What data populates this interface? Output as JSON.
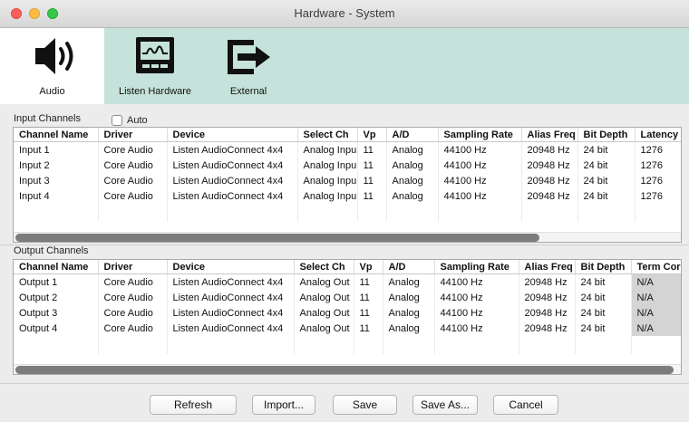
{
  "window": {
    "title": "Hardware - System"
  },
  "toolbar": {
    "items": [
      {
        "label": "Audio",
        "icon": "speaker-icon"
      },
      {
        "label": "Listen Hardware",
        "icon": "hardware-monitor-icon"
      },
      {
        "label": "External",
        "icon": "external-export-icon"
      }
    ]
  },
  "input_section": {
    "label": "Input Channels",
    "auto_label": "Auto",
    "auto_checked": false,
    "columns": [
      "Channel Name",
      "Driver",
      "Device",
      "Select Ch",
      "Vp",
      "A/D",
      "Sampling Rate",
      "Alias Freq",
      "Bit Depth",
      "Latency"
    ],
    "rows": [
      [
        "Input 1",
        "Core Audio",
        "Listen AudioConnect 4x4",
        "Analog Inpu",
        "11",
        "Analog",
        "44100 Hz",
        "20948 Hz",
        "24 bit",
        "1276"
      ],
      [
        "Input 2",
        "Core Audio",
        "Listen AudioConnect 4x4",
        "Analog Inpu",
        "11",
        "Analog",
        "44100 Hz",
        "20948 Hz",
        "24 bit",
        "1276"
      ],
      [
        "Input 3",
        "Core Audio",
        "Listen AudioConnect 4x4",
        "Analog Inpu",
        "11",
        "Analog",
        "44100 Hz",
        "20948 Hz",
        "24 bit",
        "1276"
      ],
      [
        "Input 4",
        "Core Audio",
        "Listen AudioConnect 4x4",
        "Analog Inpu",
        "11",
        "Analog",
        "44100 Hz",
        "20948 Hz",
        "24 bit",
        "1276"
      ]
    ]
  },
  "output_section": {
    "label": "Output Channels",
    "columns": [
      "Channel Name",
      "Driver",
      "Device",
      "Select Ch",
      "Vp",
      "A/D",
      "Sampling Rate",
      "Alias Freq",
      "Bit Depth",
      "Term Cor"
    ],
    "rows": [
      [
        "Output 1",
        "Core Audio",
        "Listen AudioConnect 4x4",
        "Analog Out",
        "11",
        "Analog",
        "44100 Hz",
        "20948 Hz",
        "24 bit",
        "N/A"
      ],
      [
        "Output 2",
        "Core Audio",
        "Listen AudioConnect 4x4",
        "Analog Out",
        "11",
        "Analog",
        "44100 Hz",
        "20948 Hz",
        "24 bit",
        "N/A"
      ],
      [
        "Output 3",
        "Core Audio",
        "Listen AudioConnect 4x4",
        "Analog Out",
        "11",
        "Analog",
        "44100 Hz",
        "20948 Hz",
        "24 bit",
        "N/A"
      ],
      [
        "Output 4",
        "Core Audio",
        "Listen AudioConnect 4x4",
        "Analog Out",
        "11",
        "Analog",
        "44100 Hz",
        "20948 Hz",
        "24 bit",
        "N/A"
      ]
    ]
  },
  "buttons": {
    "refresh": "Refresh",
    "import": "Import...",
    "save": "Save",
    "save_as": "Save As...",
    "cancel": "Cancel"
  },
  "colors": {
    "toolbar_bg": "#c5e3da",
    "selected_tab_bg": "#ffffff",
    "term_cell_bg": "#d4d4d4"
  }
}
